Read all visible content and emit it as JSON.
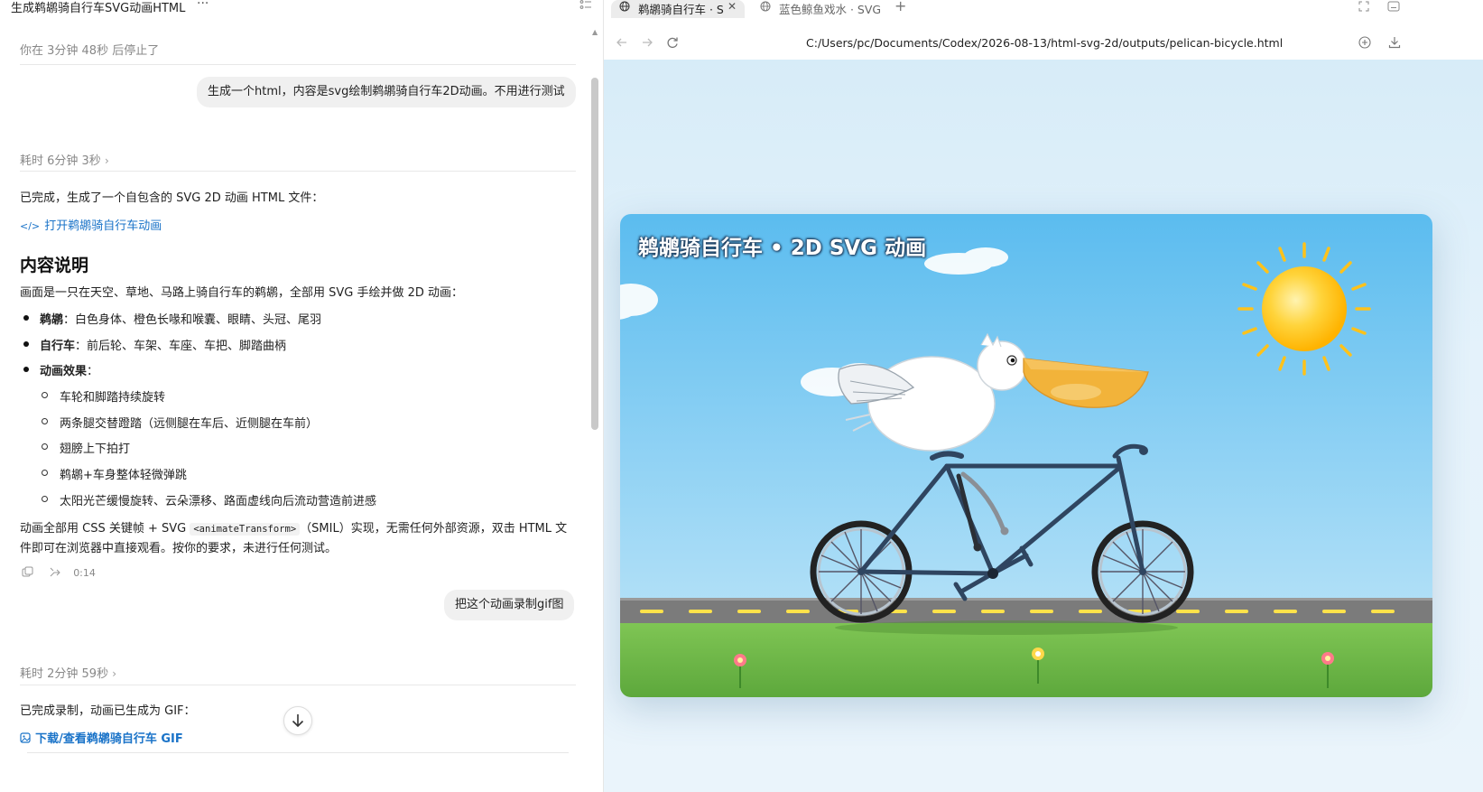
{
  "left": {
    "title": "生成鹈鹕骑自行车SVG动画HTML",
    "more": "···",
    "stopped_notice": "你在 3分钟 48秒 后停止了",
    "user_msg1": "生成一个html，内容是svg绘制鹈鹕骑自行车2D动画。不用进行测试",
    "elapsed1": "耗时 6分钟 3秒",
    "done_text": "已完成，生成了一个自包含的 SVG 2D 动画 HTML 文件：",
    "open_link": "打开鹈鹕骑自行车动画",
    "heading": "内容说明",
    "intro": "画面是一只在天空、草地、马路上骑自行车的鹈鹕，全部用 SVG 手绘并做 2D 动画：",
    "bullets": [
      {
        "label": "鹈鹕",
        "text": "：白色身体、橙色长喙和喉囊、眼睛、头冠、尾羽"
      },
      {
        "label": "自行车",
        "text": "：前后轮、车架、车座、车把、脚踏曲柄"
      },
      {
        "label": "动画效果",
        "text": "："
      }
    ],
    "sub_bullets": [
      "车轮和脚踏持续旋转",
      "两条腿交替蹬踏（远侧腿在车后、近侧腿在车前）",
      "翅膀上下拍打",
      "鹈鹕+车身整体轻微弹跳",
      "太阳光芒缓慢旋转、云朵漂移、路面虚线向后流动营造前进感"
    ],
    "summary_a": "动画全部用 CSS 关键帧 + SVG ",
    "summary_code": "<animateTransform>",
    "summary_b": "（SMIL）实现，无需任何外部资源，双击 HTML 文",
    "summary_c": "件即可在浏览器中直接观看。按你的要求，未进行任何测试。",
    "duration": "0:14",
    "user_msg2": "把这个动画录制gif图",
    "elapsed2": "耗时 2分钟 59秒",
    "done_text2": "已完成录制，动画已生成为 GIF：",
    "gif_link": "下载/查看鹈鹕骑自行车 GIF"
  },
  "browser": {
    "tabs": [
      {
        "label": "鹈鹕骑自行车 · S"
      },
      {
        "label": "蓝色鲸鱼戏水 · SVG"
      }
    ],
    "url": "C:/Users/pc/Documents/Codex/2026-08-13/html-svg-2d/outputs/pelican-bicycle.html",
    "scene_title": "鹈鹕骑自行车 • 2D SVG 动画"
  },
  "colors": {
    "link": "#1a73c8",
    "sky_top": "#5fbef0",
    "sky_bottom": "#a9dcf6",
    "grass": "#79c050",
    "road": "#7b7b7b",
    "sun": "#ffc21a",
    "beak": "#f2b33a",
    "frame": "#2f4560"
  }
}
